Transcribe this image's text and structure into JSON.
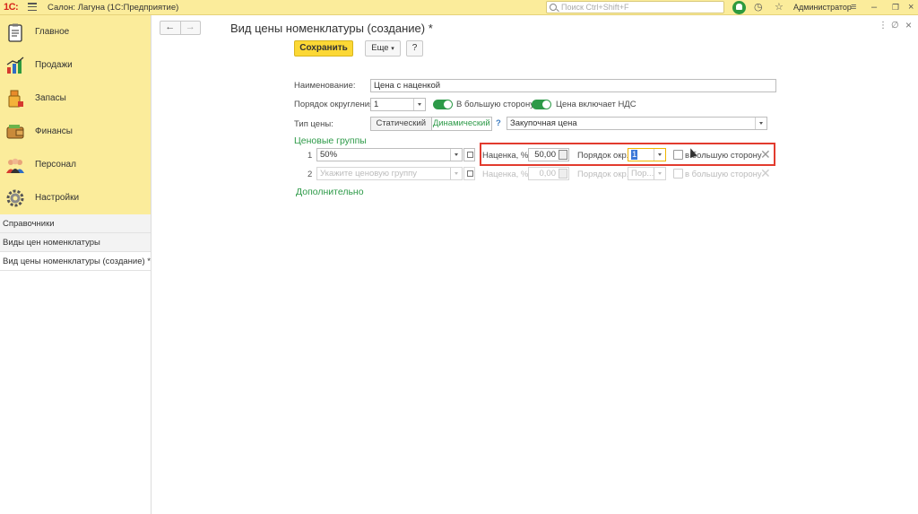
{
  "topbar": {
    "logo": "1С:",
    "app_title": "Салон: Лагуна  (1С:Предприятие)",
    "search_placeholder": "Поиск Ctrl+Shift+F",
    "user": "Администратор"
  },
  "sidebar": {
    "sections": [
      {
        "label": "Главное",
        "icon": "clipboard-icon"
      },
      {
        "label": "Продажи",
        "icon": "sales-chart-icon"
      },
      {
        "label": "Запасы",
        "icon": "stock-icon"
      },
      {
        "label": "Финансы",
        "icon": "wallet-icon"
      },
      {
        "label": "Персонал",
        "icon": "people-icon"
      },
      {
        "label": "Настройки",
        "icon": "gear-icon"
      }
    ],
    "links": [
      "Справочники",
      "Виды цен номенклатуры",
      "Вид цены номенклатуры (создание) *"
    ]
  },
  "form": {
    "title": "Вид цены номенклатуры (создание) *",
    "save_label": "Сохранить",
    "more_label": "Еще",
    "help_label": "?",
    "name_label": "Наименование:",
    "name_value": "Цена с наценкой",
    "rounding_label": "Порядок округления:",
    "rounding_value": "1",
    "round_up_label": "В большую сторону",
    "vat_label": "Цена включает НДС",
    "price_type_label": "Тип цены:",
    "price_type_static": "Статический",
    "price_type_dynamic": "Динамический",
    "price_type_help": "?",
    "base_price_value": "Закупочная цена",
    "groups_title": "Ценовые группы",
    "groups": [
      {
        "num": "1",
        "group": "50%",
        "markup_label": "Наценка, %:",
        "markup": "50,00",
        "order_label": "Порядок окр.:",
        "order": "1",
        "round_up_label": "в большую сторону"
      },
      {
        "num": "2",
        "group_placeholder": "Укажите ценовую группу",
        "markup_label": "Наценка, %:",
        "markup": "0,00",
        "order_label": "Порядок окр.:",
        "order_placeholder": "Пор...",
        "round_up_label": "в большую сторону"
      }
    ],
    "additional_link": "Дополнительно"
  },
  "colors": {
    "accent_yellow": "#fbec9b",
    "save_button": "#fcd835",
    "toggle_green": "#2d9a48",
    "highlight_red": "#e23b2e"
  }
}
